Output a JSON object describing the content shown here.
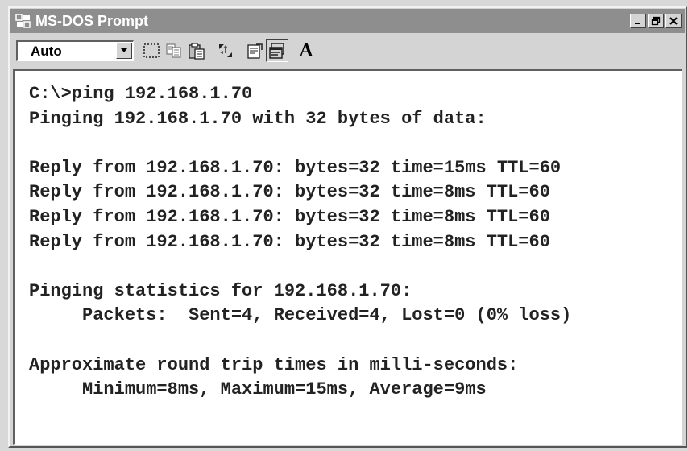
{
  "window": {
    "title": "MS-DOS Prompt"
  },
  "title_controls": {
    "minimize": "_",
    "restore": "□",
    "close": "X"
  },
  "toolbar": {
    "font_size": "Auto",
    "tools": [
      "mark-icon",
      "copy-icon",
      "paste-icon",
      "fullscreen-icon",
      "properties-icon",
      "background-icon",
      "font-icon"
    ],
    "font_button": "A"
  },
  "console": {
    "lines": [
      "C:\\>ping 192.168.1.70",
      "Pinging 192.168.1.70 with 32 bytes of data:",
      "",
      "Reply from 192.168.1.70: bytes=32 time=15ms TTL=60",
      "Reply from 192.168.1.70: bytes=32 time=8ms TTL=60",
      "Reply from 192.168.1.70: bytes=32 time=8ms TTL=60",
      "Reply from 192.168.1.70: bytes=32 time=8ms TTL=60",
      "",
      "Pinging statistics for 192.168.1.70:",
      "     Packets:  Sent=4, Received=4, Lost=0 (0% loss)",
      "",
      "Approximate round trip times in milli-seconds:",
      "     Minimum=8ms, Maximum=15ms, Average=9ms"
    ]
  }
}
